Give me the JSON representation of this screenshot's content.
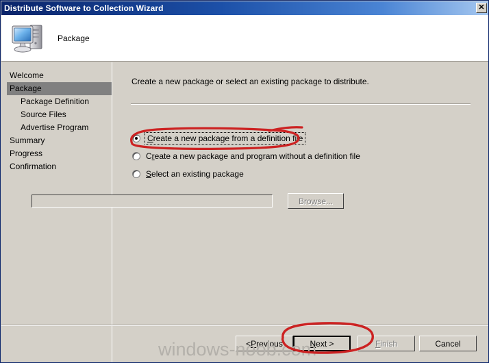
{
  "window": {
    "title": "Distribute Software to Collection Wizard",
    "close_label": "✕"
  },
  "header": {
    "title": "Package",
    "icon": "computer-icon"
  },
  "sidebar": {
    "items": [
      {
        "label": "Welcome",
        "level": 0,
        "active": false
      },
      {
        "label": "Package",
        "level": 0,
        "active": true
      },
      {
        "label": "Package Definition",
        "level": 1,
        "active": false
      },
      {
        "label": "Source Files",
        "level": 1,
        "active": false
      },
      {
        "label": "Advertise Program",
        "level": 1,
        "active": false
      },
      {
        "label": "Summary",
        "level": 0,
        "active": false
      },
      {
        "label": "Progress",
        "level": 0,
        "active": false
      },
      {
        "label": "Confirmation",
        "level": 0,
        "active": false
      }
    ]
  },
  "main": {
    "intro": "Create a new package or select an existing package to distribute.",
    "options": [
      {
        "pre": "",
        "accel": "C",
        "post": "reate a new package from a definition file",
        "selected": true,
        "focused": true
      },
      {
        "pre": "C",
        "accel": "r",
        "post": "eate a new package and program without a definition file",
        "selected": false,
        "focused": false
      },
      {
        "pre": "",
        "accel": "S",
        "post": "elect an existing package",
        "selected": false,
        "focused": false
      }
    ],
    "path_value": "",
    "path_placeholder": "",
    "browse": {
      "pre": "Bro",
      "accel": "w",
      "post": "se..."
    }
  },
  "buttons": {
    "previous": {
      "pre": "< ",
      "accel": "P",
      "post": "revious"
    },
    "next": {
      "pre": "",
      "accel": "N",
      "post": "ext >"
    },
    "finish": {
      "pre": "",
      "accel": "F",
      "post": "inish"
    },
    "cancel": {
      "pre": "",
      "accel": "",
      "post": "Cancel"
    }
  },
  "watermark": "windows-noob.com",
  "colors": {
    "title_gradient_start": "#0a246a",
    "title_gradient_end": "#a6c8f0",
    "dialog_face": "#d4d0c8",
    "highlight": "#808080",
    "annotation_red": "#cc2222"
  }
}
